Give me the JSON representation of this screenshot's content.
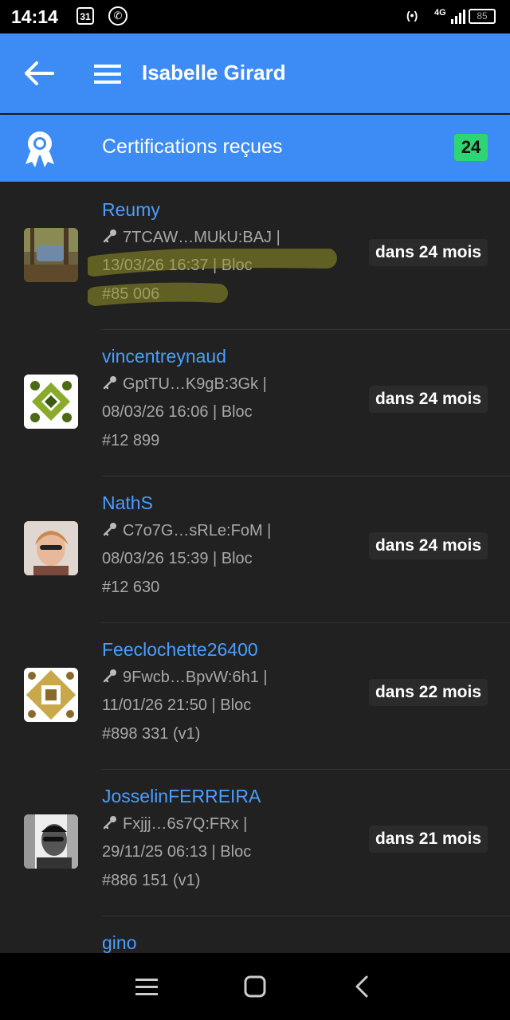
{
  "status_bar": {
    "time": "14:14",
    "calendar_day": "31",
    "hotspot": "(•)",
    "network": "4G",
    "battery": "85"
  },
  "app_bar": {
    "title": "Isabelle Girard"
  },
  "section": {
    "label": "Certifications reçues",
    "count": "24",
    "count_color": "#2ed573"
  },
  "certifications": [
    {
      "name": "Reumy",
      "key": "7TCAW…MUkU:BAJ |",
      "date_line": "13/03/26 16:37 | Bloc",
      "block": "#85 006",
      "expiry": "dans 24 mois"
    },
    {
      "name": "vincentreynaud",
      "key": "GptTU…K9gB:3Gk |",
      "date_line": "08/03/26 16:06 | Bloc",
      "block": "#12 899",
      "expiry": "dans 24 mois"
    },
    {
      "name": "NathS",
      "key": "C7o7G…sRLe:FoM |",
      "date_line": "08/03/26 15:39 | Bloc",
      "block": "#12 630",
      "expiry": "dans 24 mois"
    },
    {
      "name": "Feeclochette26400",
      "key": "9Fwcb…BpvW:6h1 |",
      "date_line": "11/01/26 21:50 | Bloc",
      "block": "#898 331 (v1)",
      "expiry": "dans 22 mois"
    },
    {
      "name": "JosselinFERREIRA",
      "key": "Fxjjj…6s7Q:FRx |",
      "date_line": "29/11/25 06:13 | Bloc",
      "block": "#886 151 (v1)",
      "expiry": "dans 21 mois"
    },
    {
      "name": "gino"
    }
  ],
  "colors": {
    "accent": "#3d8bf5",
    "link": "#4a9eff",
    "background": "#212121"
  }
}
